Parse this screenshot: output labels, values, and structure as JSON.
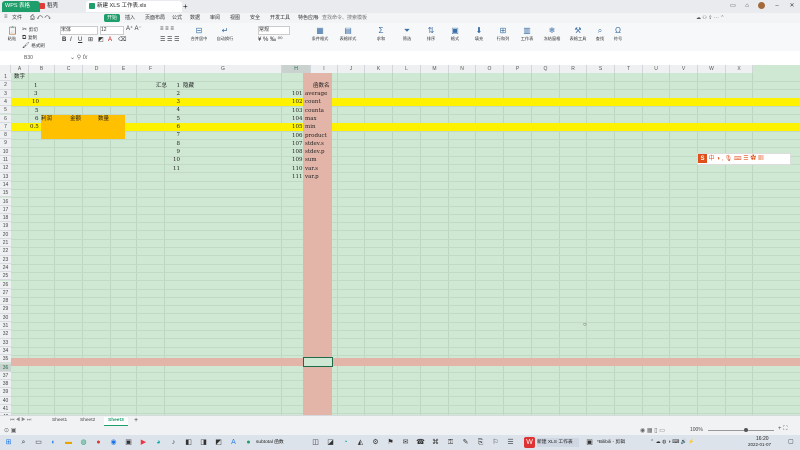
{
  "titlebar": {
    "tabs": [
      "WPS 表格",
      "稻壳",
      "新建 XLS 工作表.xls"
    ],
    "add_tab": "+"
  },
  "menubar": {
    "items": [
      "文件",
      "开始",
      "插入",
      "页面布局",
      "公式",
      "数据",
      "审阅",
      "视图",
      "安全",
      "开发工具",
      "特色应用",
      "文档助手"
    ],
    "search": "查找命令、搜索模板",
    "active_index": 1
  },
  "ribbon": {
    "paste": "粘贴",
    "cut": "剪切",
    "copy": "复制",
    "format_painter": "格式刷",
    "font_name": "宋体",
    "font_size": "12",
    "merge": "合并居中",
    "wrap": "自动换行",
    "number_format": "常规",
    "items": [
      "条件格式",
      "表格样式",
      "求和",
      "筛选",
      "排序",
      "格式",
      "填充",
      "行和列",
      "工作表",
      "冻结窗格",
      "表格工具",
      "查找",
      "符号"
    ]
  },
  "formula_bar": {
    "name_box": "B30",
    "fx": "fx"
  },
  "columns": [
    "A",
    "B",
    "C",
    "D",
    "E",
    "F",
    "G",
    "H",
    "I",
    "J",
    "K",
    "L",
    "M",
    "N",
    "O",
    "P",
    "Q",
    "R",
    "S",
    "T",
    "U",
    "V",
    "W",
    "X"
  ],
  "rows": [
    "1",
    "2",
    "3",
    "4",
    "5",
    "6",
    "7",
    "8",
    "9",
    "10",
    "11",
    "12",
    "13",
    "14",
    "15",
    "16",
    "17",
    "18",
    "19",
    "20",
    "21",
    "22",
    "23",
    "24",
    "25",
    "26",
    "27",
    "28",
    "29",
    "30",
    "31",
    "32",
    "33",
    "34",
    "35",
    "36",
    "37",
    "38",
    "39",
    "40",
    "41",
    "42"
  ],
  "cells": {
    "a1": "数字",
    "b2": "1",
    "b3": "3",
    "b4": "10",
    "b5": "5",
    "a6": "6",
    "b6": "利润",
    "c6": "金额",
    "d6": "数量",
    "a7": "0.5",
    "f2": "汇总",
    "g2": "隐藏",
    "f_list": [
      "1",
      "2",
      "3",
      "4",
      "5",
      "6",
      "7",
      "8",
      "9",
      "10",
      "11"
    ],
    "h2": "函数名",
    "h_num": [
      "101",
      "102",
      "103",
      "104",
      "105",
      "106",
      "107",
      "108",
      "109",
      "110",
      "111"
    ],
    "h_fn": [
      "average",
      "count",
      "counta",
      "max",
      "min",
      "product",
      "stdev.s",
      "stdev.p",
      "sum",
      "var.s",
      "var.p"
    ]
  },
  "sheets": [
    "Sheet1",
    "Sheet2",
    "Sheet3"
  ],
  "active_sheet": 2,
  "statusbar": {
    "zoom": "100%"
  },
  "taskbar": {
    "items": [
      "subtotal 函数",
      "新建 XLS 工作表",
      "*Bilibili - 剪辑"
    ],
    "time": "16:20",
    "date": "2022-01-07"
  },
  "colors": {
    "grid_bg": "#cfe8d3",
    "highlight_row": "#fff200",
    "orange_block": "#ffc000",
    "selected_col": "#e2b5a8",
    "accent": "#1e9e6a"
  }
}
